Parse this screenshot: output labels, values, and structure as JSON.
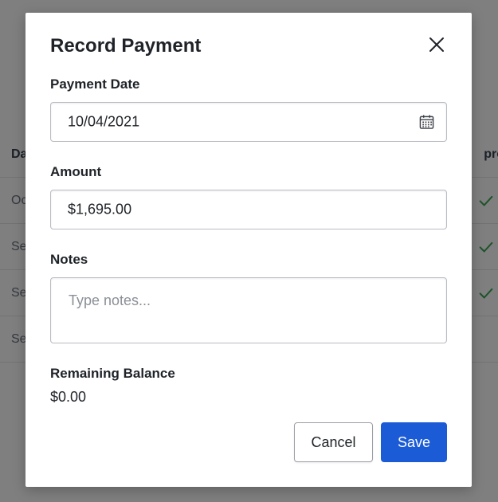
{
  "background": {
    "table": {
      "header": {
        "left_text": "Da",
        "right_text": "pro"
      },
      "rows": [
        {
          "left_text": "Oc",
          "approved": true
        },
        {
          "left_text": "Se",
          "approved": true
        },
        {
          "left_text": "Se",
          "approved": true
        },
        {
          "left_text": "Se",
          "approved": false
        }
      ]
    }
  },
  "modal": {
    "title": "Record Payment",
    "close_icon": "close-icon",
    "payment_date": {
      "label": "Payment Date",
      "value": "10/04/2021",
      "icon": "calendar-icon"
    },
    "amount": {
      "label": "Amount",
      "value": "$1,695.00"
    },
    "notes": {
      "label": "Notes",
      "value": "",
      "placeholder": "Type notes..."
    },
    "remaining_balance": {
      "label": "Remaining Balance",
      "value": "$0.00"
    },
    "buttons": {
      "cancel_label": "Cancel",
      "save_label": "Save"
    }
  },
  "colors": {
    "primary": "#1b5bd6",
    "overlay": "rgba(0,0,0,0.5)",
    "check_green": "#3aa757"
  }
}
